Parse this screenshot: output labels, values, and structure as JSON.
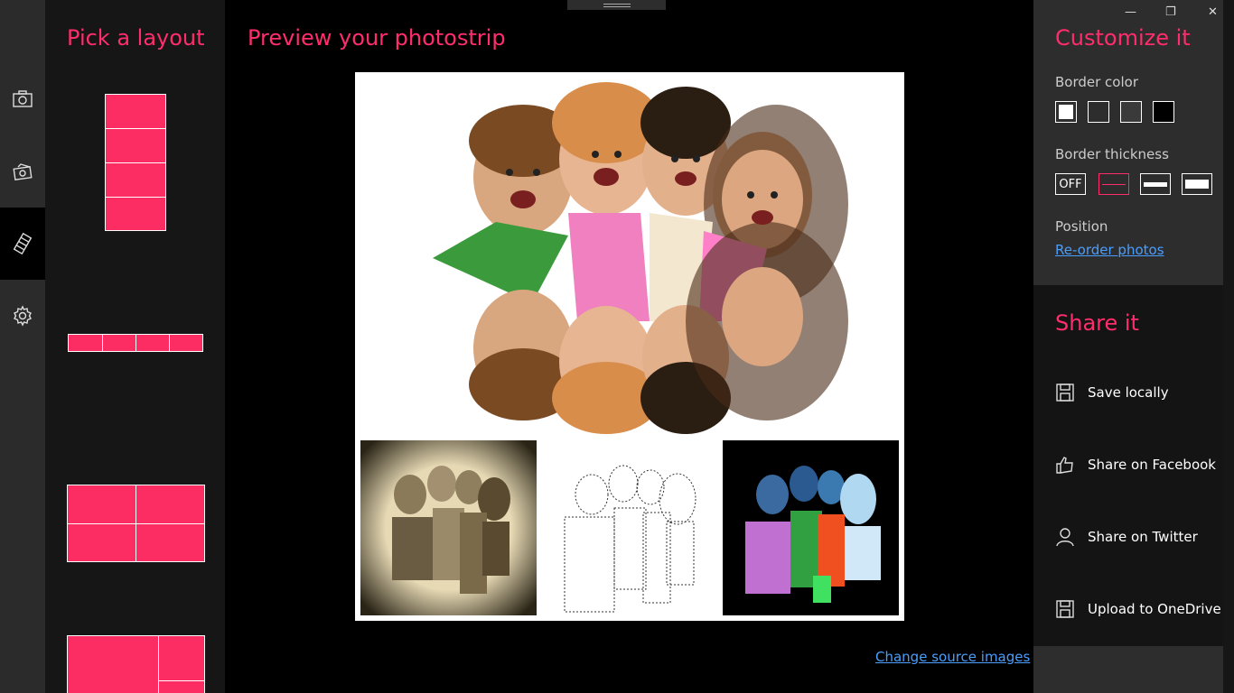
{
  "nav": {
    "items": [
      "camera-icon",
      "photos-icon",
      "filmstrip-icon",
      "gear-icon"
    ],
    "active_index": 2
  },
  "layouts": {
    "heading": "Pick a layout"
  },
  "preview": {
    "heading": "Preview your photostrip",
    "change_link": "Change source images"
  },
  "customize": {
    "heading": "Customize it",
    "border_color_label": "Border color",
    "border_colors": [
      "#ffffff",
      "#2d2d2d",
      "#3a3a3a",
      "#000000"
    ],
    "border_thickness_label": "Border thickness",
    "thickness_off": "OFF",
    "position_label": "Position",
    "reorder_link": "Re-order photos"
  },
  "share": {
    "heading": "Share it",
    "items": [
      "Save locally",
      "Share on Facebook",
      "Share on Twitter",
      "Upload to OneDrive"
    ]
  },
  "colors": {
    "accent": "#ff2d6b",
    "layout_fill": "#fb2d63",
    "link": "#4a9eff"
  }
}
